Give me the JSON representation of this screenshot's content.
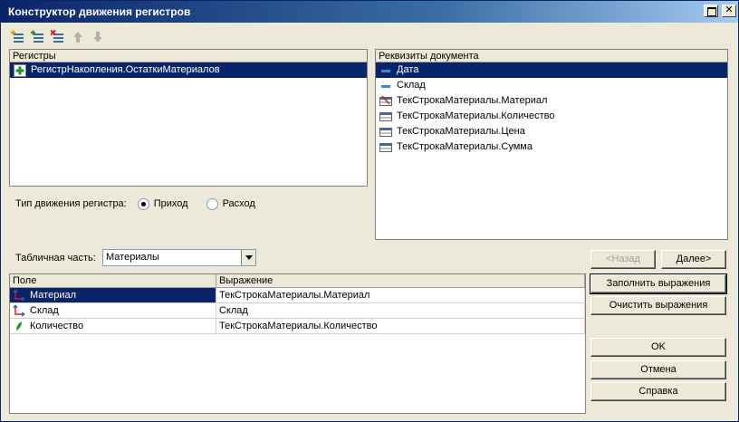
{
  "window": {
    "title": "Конструктор движения регистров"
  },
  "toolbar": {
    "buttons": [
      {
        "icon": "add-register-icon"
      },
      {
        "icon": "add-all-registers-icon"
      },
      {
        "icon": "delete-register-icon"
      },
      {
        "icon": "move-up-icon"
      },
      {
        "icon": "move-down-icon"
      }
    ]
  },
  "registers": {
    "header": "Регистры",
    "items": [
      {
        "label": "РегистрНакопления.ОстаткиМатериалов",
        "icon": "register-plus-icon",
        "selected": true
      }
    ]
  },
  "movement_type": {
    "label": "Тип движения регистра:",
    "options": [
      {
        "label": "Приход",
        "checked": true
      },
      {
        "label": "Расход",
        "checked": false
      }
    ]
  },
  "doc_attributes": {
    "header": "Реквизиты документа",
    "items": [
      {
        "label": "Дата",
        "icon": "attribute-icon",
        "selected": true
      },
      {
        "label": "Склад",
        "icon": "attribute-icon",
        "selected": false
      },
      {
        "label": "ТекСтрокаМатериалы.Материал",
        "icon": "tabular-attribute-icon",
        "selected": false
      },
      {
        "label": "ТекСтрокаМатериалы.Количество",
        "icon": "tabular-attribute-icon",
        "selected": false
      },
      {
        "label": "ТекСтрокаМатериалы.Цена",
        "icon": "tabular-attribute-icon",
        "selected": false
      },
      {
        "label": "ТекСтрокаМатериалы.Сумма",
        "icon": "tabular-attribute-icon",
        "selected": false
      }
    ]
  },
  "tabular_part": {
    "label": "Табличная часть:",
    "value": "Материалы"
  },
  "nav": {
    "back": "<Назад",
    "next": "Далее>"
  },
  "fields_table": {
    "columns": [
      "Поле",
      "Выражение"
    ],
    "rows": [
      {
        "field": "Материал",
        "expression": "ТекСтрокаМатериалы.Материал",
        "icon": "dimension-icon",
        "selected": true
      },
      {
        "field": "Склад",
        "expression": "Склад",
        "icon": "dimension-icon",
        "selected": false
      },
      {
        "field": "Количество",
        "expression": "ТекСтрокаМатериалы.Количество",
        "icon": "resource-icon",
        "selected": false
      }
    ]
  },
  "actions": {
    "fill": "Заполнить выражения",
    "clear": "Очистить выражения",
    "ok": "OK",
    "cancel": "Отмена",
    "help": "Справка"
  },
  "colors": {
    "selection": "#0A246A",
    "face": "#ECE9D8"
  }
}
